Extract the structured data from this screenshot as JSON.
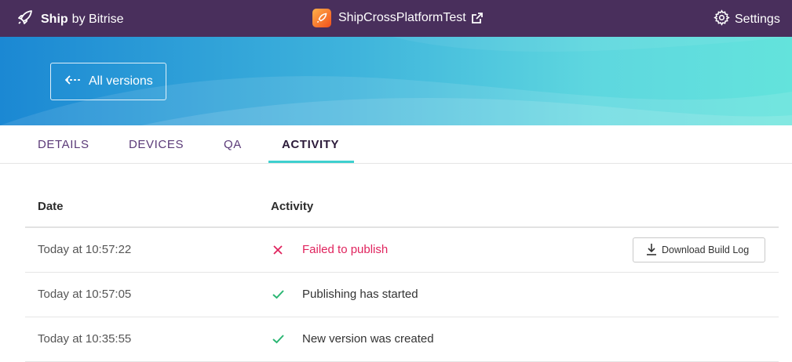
{
  "topbar": {
    "brand_bold": "Ship",
    "brand_light": "by Bitrise",
    "app_name": "ShipCrossPlatformTest",
    "settings_label": "Settings"
  },
  "hero": {
    "back_label": "All versions"
  },
  "tabs": [
    {
      "label": "DETAILS",
      "active": false
    },
    {
      "label": "DEVICES",
      "active": false
    },
    {
      "label": "QA",
      "active": false
    },
    {
      "label": "ACTIVITY",
      "active": true
    }
  ],
  "table": {
    "headers": {
      "date": "Date",
      "activity": "Activity"
    },
    "rows": [
      {
        "date": "Today at 10:57:22",
        "status": "failed",
        "activity": "Failed to publish",
        "action_label": "Download Build Log"
      },
      {
        "date": "Today at 10:57:05",
        "status": "success",
        "activity": "Publishing has started"
      },
      {
        "date": "Today at 10:35:55",
        "status": "success",
        "activity": "New version was created"
      }
    ]
  },
  "icons": {
    "brand": "rocket-icon",
    "external_link": "external-link-icon",
    "settings": "gear-icon",
    "back": "arrow-left-icon",
    "failed": "cross-icon",
    "success": "check-icon",
    "download": "download-icon"
  },
  "colors": {
    "topbar": "#492f5c",
    "tab_active_underline": "#3ed0cf",
    "failed": "#e0245e",
    "success": "#2bb673",
    "tab_text": "#5b3a78"
  }
}
